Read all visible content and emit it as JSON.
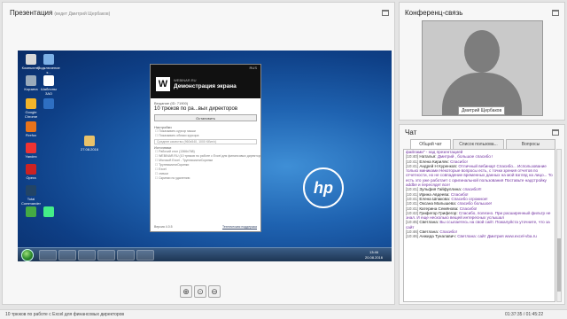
{
  "presentation": {
    "title": "Презентация",
    "presenter": "(ведет Дмитрий Щербаков)"
  },
  "desktop": {
    "icons": [
      {
        "label": "Компьютер",
        "color": "#d8d8d8"
      },
      {
        "label": "Подключение к...",
        "color": "#7cb0e6"
      },
      {
        "label": "Корзина",
        "color": "#9ab"
      },
      {
        "label": "Шаблоны ЗАО",
        "color": "#fff"
      },
      {
        "label": "Google Chrome",
        "color": "#f3b52b"
      },
      {
        "label": "",
        "color": "#2e6fc2"
      },
      {
        "label": "Firefox",
        "color": "#e8731b"
      },
      {
        "label": "Yandex",
        "color": "#e33"
      },
      {
        "label": "Opera",
        "color": "#c22"
      },
      {
        "label": "Total Commander",
        "color": "#246"
      },
      {
        "label": "",
        "color": "#4a4"
      },
      {
        "label": "",
        "color": "#4e8"
      },
      {
        "label": "27.08.2016",
        "color": "#e8c26a"
      }
    ],
    "clock_time": "13:46",
    "clock_date": "20.08.2016",
    "brand": "hp"
  },
  "app": {
    "titlebar": "RUS",
    "site": "WEBINAR.RU",
    "demo_title": "Демонстрация экрана",
    "session_label": "Вещание (ID: 71900)",
    "webinar_name": "10 трюков по ра...вых директоров",
    "stop_button": "Остановить",
    "settings_label": "Настройки",
    "settings_options": [
      "Показывать курсор мыши",
      "Показывать облако курсора"
    ],
    "quality_select": "Среднее качество (960x540, 1000 Кбит/с)",
    "sources_label": "Источники",
    "sources": [
      "Рабочий стол (1366x768)",
      "WEBINAR.RU (10 трюков по работе с Excel для финансовых директоров)",
      "Microsoft Excel - ТрупникиилиСкрипки",
      "ТрупникиилиСкрипки",
      "Excel",
      "значки",
      "Скрипки по удалению"
    ],
    "version": "Версия 4.0.5",
    "support_link": "Техническая поддержка"
  },
  "zoom_buttons": [
    "zoom-in",
    "zoom-reset",
    "zoom-out"
  ],
  "conference": {
    "title": "Конференц-связь",
    "speaker": "Дмитрий Щербаков"
  },
  "chat": {
    "title": "Чат",
    "tabs": [
      "Общий чат",
      "Список пользова...",
      "Вопросы"
    ],
    "messages": [
      {
        "time": "",
        "author": "",
        "text": "файлами\" - над презентацией"
      },
      {
        "time": "[10:40]",
        "author": "Наталья:",
        "text": "Дмитрий , большое спасибо !"
      },
      {
        "time": "[10:41]",
        "author": "Елена Кириляк:",
        "text": "Спасибо!"
      },
      {
        "time": "[10:41]",
        "author": "Андрей Н Куренков:",
        "text": "Отличный вебинар! Спасибо... Использование только миниками Некоторые вопросы есть, с точки зрения отчетов по отчетности, но не совпадение временных данных на мой взгляд на лицо... То есть это уже работает с оригинальной пользования Поставьте надстройку addbe и пересядет все!"
      },
      {
        "time": "[10:41]",
        "author": "Зульфия Гайфуллина:",
        "text": "спасибо!!!"
      },
      {
        "time": "[10:41]",
        "author": "Ирина Авдеева:",
        "text": "Спасибо!"
      },
      {
        "time": "[10:41]",
        "author": "Елена Шпакова:",
        "text": "Спасибо огромное!"
      },
      {
        "time": "[10:41]",
        "author": "Оксана Малышева:",
        "text": "спасибо большое!"
      },
      {
        "time": "[10:41]",
        "author": "Катерина Семёнова:",
        "text": "Спасибо!"
      },
      {
        "time": "[10:42]",
        "author": "Грифегор Грифегор:",
        "text": "Спасибо, полезно. При расширенный фильтр не знал. И еще несколько вещей интересных услышал"
      },
      {
        "time": "[10:45]",
        "author": "Светлана:",
        "text": "Вы ссылаетесь на свой сайт. Пожалуйста уточните, что за сайт"
      },
      {
        "time": "[10:46]",
        "author": "Светлана:",
        "text": "Спасибо!"
      },
      {
        "time": "[10:46]",
        "author": "Анжида Туналавич:",
        "text": "Светлана: сайт Дмитрия www.excel-vba.ru"
      }
    ]
  },
  "status": {
    "webinar_title": "10 трюков по работе с Excel для финансовых директоров",
    "time": "01:37:35 / 01:45:22"
  }
}
